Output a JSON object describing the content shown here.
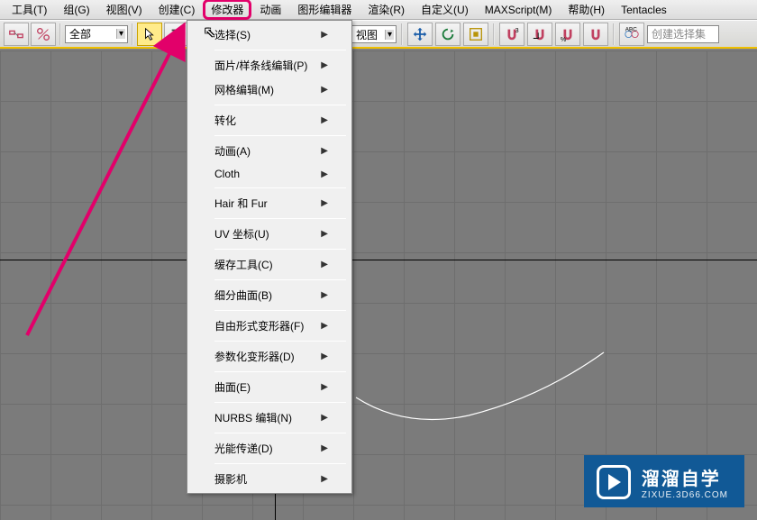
{
  "menubar": {
    "items": [
      "工具(T)",
      "组(G)",
      "视图(V)",
      "创建(C)",
      "修改器",
      "动画",
      "图形编辑器",
      "渲染(R)",
      "自定义(U)",
      "MAXScript(M)",
      "帮助(H)",
      "Tentacles"
    ],
    "highlighted_index": 4
  },
  "toolbar": {
    "selection_set_label": "全部",
    "view_label": "视图",
    "create_set_placeholder": "创建选择集"
  },
  "dropdown": {
    "items": [
      {
        "label": "选择(S)",
        "sub": true
      },
      {
        "sep": true
      },
      {
        "label": "面片/样条线编辑(P)",
        "sub": true
      },
      {
        "label": "网格编辑(M)",
        "sub": true
      },
      {
        "sep": true
      },
      {
        "label": "转化",
        "sub": true
      },
      {
        "sep": true
      },
      {
        "label": "动画(A)",
        "sub": true
      },
      {
        "label": "Cloth",
        "sub": true
      },
      {
        "sep": true
      },
      {
        "label": "Hair 和 Fur",
        "sub": true
      },
      {
        "sep": true
      },
      {
        "label": "UV 坐标(U)",
        "sub": true
      },
      {
        "sep": true
      },
      {
        "label": "缓存工具(C)",
        "sub": true
      },
      {
        "sep": true
      },
      {
        "label": "细分曲面(B)",
        "sub": true
      },
      {
        "sep": true
      },
      {
        "label": "自由形式变形器(F)",
        "sub": true
      },
      {
        "sep": true
      },
      {
        "label": "参数化变形器(D)",
        "sub": true
      },
      {
        "sep": true
      },
      {
        "label": "曲面(E)",
        "sub": true
      },
      {
        "sep": true
      },
      {
        "label": "NURBS 编辑(N)",
        "sub": true
      },
      {
        "sep": true
      },
      {
        "label": "光能传递(D)",
        "sub": true
      },
      {
        "sep": true
      },
      {
        "label": "摄影机",
        "sub": true
      }
    ]
  },
  "watermark": {
    "title": "溜溜自学",
    "subtitle": "ZIXUE.3D66.COM"
  }
}
